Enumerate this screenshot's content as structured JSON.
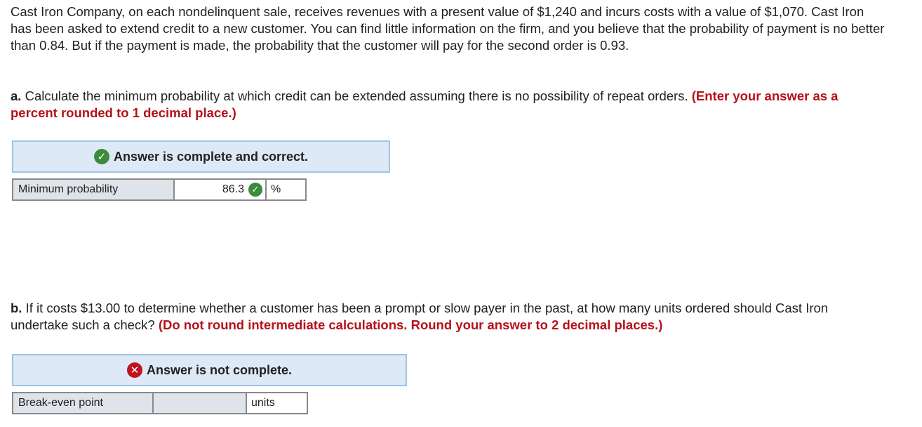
{
  "intro": "Cast Iron Company, on each nondelinquent sale, receives revenues with a present value of $1,240 and incurs costs with a value of $1,070. Cast Iron has been asked to extend credit to a new customer. You can find little information on the firm, and you believe that the probability of payment is no better than 0.84. But if the payment is made, the probability that the customer will pay for the second order is 0.93.",
  "part_a": {
    "prefix": "a.",
    "question": " Calculate the minimum probability at which credit can be extended assuming there is no possibility of repeat orders. ",
    "instruction": "(Enter your answer as a percent rounded to 1 decimal place.)",
    "banner": "Answer is complete and correct.",
    "status": "correct",
    "row": {
      "label": "Minimum probability",
      "value": "86.3",
      "unit": "%"
    }
  },
  "part_b": {
    "prefix": "b.",
    "question": " If it costs $13.00 to determine whether a customer has been a prompt or slow payer in the past, at how many units ordered should Cast Iron undertake such a check? ",
    "instruction": "(Do not round intermediate calculations. Round your answer to 2 decimal places.)",
    "banner": "Answer is not complete.",
    "status": "incomplete",
    "row": {
      "label": "Break-even point",
      "value": "",
      "unit": "units"
    }
  },
  "icons": {
    "correct": "check-circle-icon",
    "incomplete": "x-circle-icon"
  },
  "colors": {
    "instruction_red": "#b5121b",
    "banner_bg": "#dde9f6",
    "correct_green": "#3d8b3d",
    "error_red": "#c0141c"
  }
}
